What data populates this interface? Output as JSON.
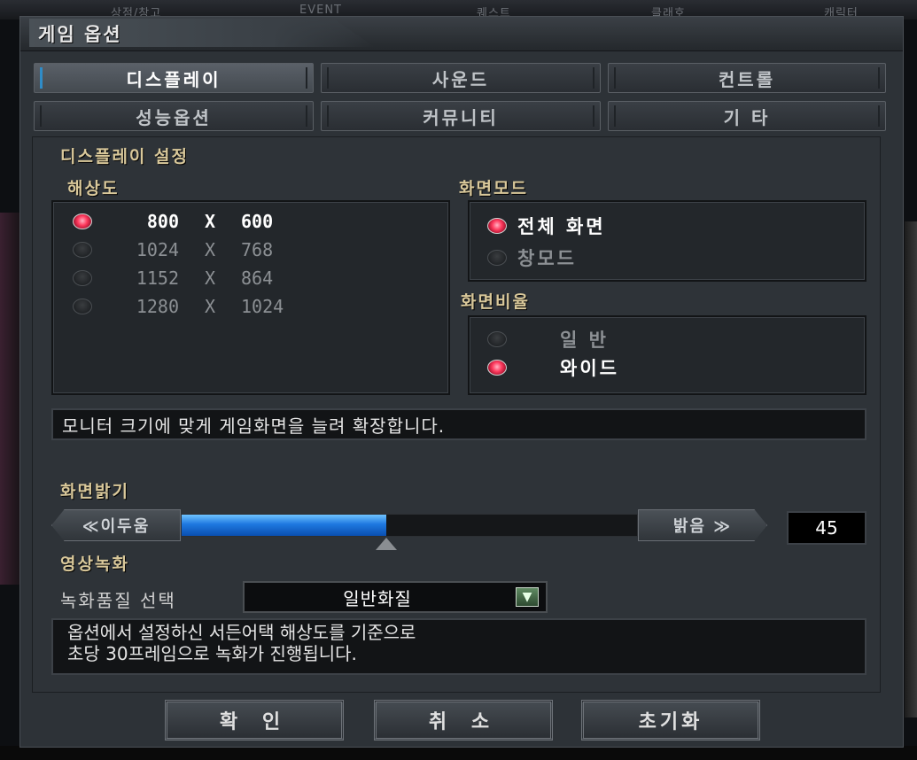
{
  "background": {
    "menu": [
      "상점/창고",
      "EVENT",
      "퀘스트",
      "클래호",
      "캐릭터"
    ]
  },
  "window": {
    "title": "게임 옵션"
  },
  "tabs": [
    {
      "label": "디스플레이",
      "active": true
    },
    {
      "label": "사운드",
      "active": false
    },
    {
      "label": "컨트롤",
      "active": false
    },
    {
      "label": "성능옵션",
      "active": false
    },
    {
      "label": "커뮤니티",
      "active": false
    },
    {
      "label": "기  타",
      "active": false
    }
  ],
  "display": {
    "section_title": "디스플레이 설정",
    "resolution": {
      "title": "해상도",
      "options": [
        {
          "w": "800",
          "x": "X",
          "h": "600",
          "selected": true
        },
        {
          "w": "1024",
          "x": "X",
          "h": "768",
          "selected": false
        },
        {
          "w": "1152",
          "x": "X",
          "h": "864",
          "selected": false
        },
        {
          "w": "1280",
          "x": "X",
          "h": "1024",
          "selected": false
        }
      ]
    },
    "screen_mode": {
      "title": "화면모드",
      "options": [
        {
          "label": "전체 화면",
          "selected": true
        },
        {
          "label": "창모드",
          "selected": false
        }
      ]
    },
    "aspect_ratio": {
      "title": "화면비율",
      "options": [
        {
          "label": "일 반",
          "selected": false
        },
        {
          "label": "와이드",
          "selected": true
        }
      ]
    },
    "description": "모니터 크기에 맞게 게임화면을 늘려 확장합니다."
  },
  "brightness": {
    "title": "화면밝기",
    "dark_label": "≪이두움",
    "bright_label": "밝음 ≫",
    "value": "45",
    "fill_percent": 45
  },
  "recording": {
    "title": "영상녹화",
    "quality_label": "녹화품질 선택",
    "quality_value": "일반화질",
    "info_lines": [
      "옵션에서 설정하신 서든어택 해상도를 기준으로",
      "초당 30프레임으로 녹화가 진행됩니다."
    ]
  },
  "buttons": {
    "confirm": "확 인",
    "cancel": "취 소",
    "reset": "초기화"
  },
  "colors": {
    "accent_blue": "#1e78e0",
    "radio_on": "#ff3a5e",
    "section_title": "#d9c89a",
    "panel_bg": "#2d3237"
  }
}
